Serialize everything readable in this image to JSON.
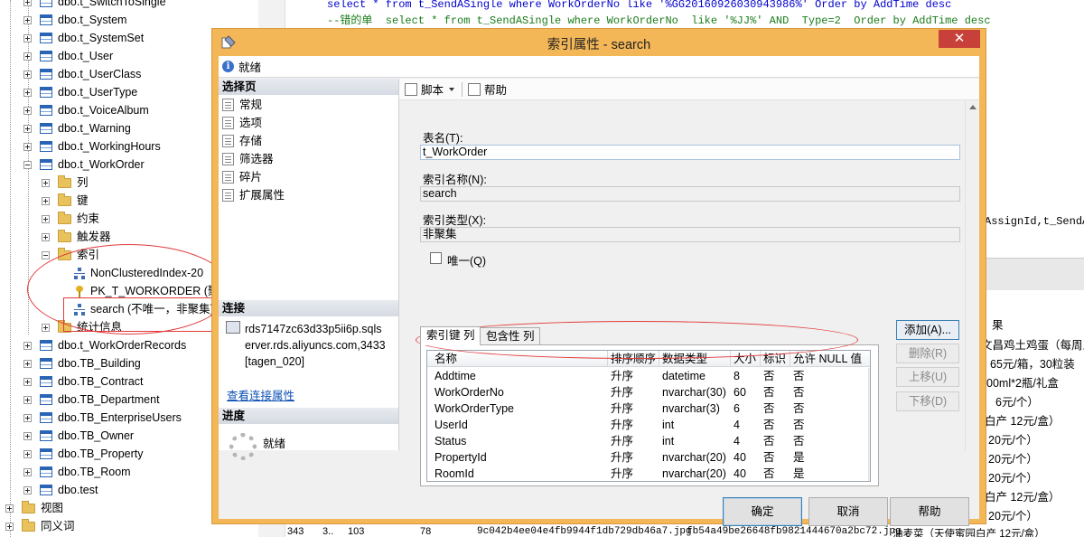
{
  "explorer": {
    "rows": [
      {
        "label": "dbo.t_SwitchToSingle"
      },
      {
        "label": "dbo.t_System"
      },
      {
        "label": "dbo.t_SystemSet"
      },
      {
        "label": "dbo.t_User"
      },
      {
        "label": "dbo.t_UserClass"
      },
      {
        "label": "dbo.t_UserType"
      },
      {
        "label": "dbo.t_VoiceAlbum"
      },
      {
        "label": "dbo.t_Warning"
      },
      {
        "label": "dbo.t_WorkingHours"
      },
      {
        "label": "dbo.t_WorkOrder"
      },
      {
        "label": "列"
      },
      {
        "label": "键"
      },
      {
        "label": "约束"
      },
      {
        "label": "触发器"
      },
      {
        "label": "索引"
      },
      {
        "label": "NonClusteredIndex-20"
      },
      {
        "label": "PK_T_WORKORDER (聚"
      },
      {
        "label": "search (不唯一，非聚集)"
      },
      {
        "label": "统计信息"
      },
      {
        "label": "dbo.t_WorkOrderRecords"
      },
      {
        "label": "dbo.TB_Building"
      },
      {
        "label": "dbo.TB_Contract"
      },
      {
        "label": "dbo.TB_Department"
      },
      {
        "label": "dbo.TB_EnterpriseUsers"
      },
      {
        "label": "dbo.TB_Owner"
      },
      {
        "label": "dbo.TB_Property"
      },
      {
        "label": "dbo.TB_Room"
      },
      {
        "label": "dbo.test"
      },
      {
        "label": "视图"
      },
      {
        "label": "同义词"
      }
    ]
  },
  "editor": {
    "line1": "select * from t_SendASingle where WorkOrderNo like '%GG20160926030943986%' Order by AddTime desc",
    "line2": "--错的单  select * from t_SendASingle where WorkOrderNo  like '%JJ%' AND  Type=2  Order by AddTime desc",
    "right_fragment": "AssignId,t_SendA",
    "results_header": "果",
    "result_lines": [
      "文昌鸡土鸡蛋（每周五",
      "65元/箱，30粒装",
      "00ml*2瓶/礼盒",
      "6元/个）",
      "白产 12元/盒）",
      "20元/个）",
      "20元/个）",
      "20元/个）",
      "白产 12元/盒）"
    ],
    "bottom_row": {
      "c1": "343",
      "c2": "3..",
      "c3": "103",
      "c4": "78",
      "c5": "9c042b4ee04e4fb9944f1db729db46a7.jpg",
      "c6": "fb54a49be26648fb9821444670a2bc72.jpg",
      "c7": "油麦菜（天使蜜园白产 12元/盒）"
    }
  },
  "dialog": {
    "title": "索引属性 - search",
    "close_glyph": "✕",
    "status": "就绪",
    "select_page_header": "选择页",
    "pages": [
      {
        "label": "常规"
      },
      {
        "label": "选项"
      },
      {
        "label": "存储"
      },
      {
        "label": "筛选器"
      },
      {
        "label": "碎片"
      },
      {
        "label": "扩展属性"
      }
    ],
    "connection_header": "连接",
    "connection_text_line1": "rds7147zc63d33p5ii6p.sqls",
    "connection_text_line2": "erver.rds.aliyuncs.com,3433",
    "connection_text_line3": "[tagen_020]",
    "view_connection_link": "查看连接属性",
    "progress_header": "进度",
    "progress_text": "就绪",
    "toolbar": {
      "script": "脚本",
      "help": "帮助"
    },
    "table_name_label": "表名(T):",
    "table_name_value": "t_WorkOrder",
    "index_name_label": "索引名称(N):",
    "index_name_value": "search",
    "index_type_label": "索引类型(X):",
    "index_type_value": "非聚集",
    "unique_label": "唯一(Q)",
    "tabs": [
      {
        "label": "索引键 列"
      },
      {
        "label": "包含性 列"
      }
    ],
    "grid": {
      "headers": [
        "名称",
        "排序顺序",
        "数据类型",
        "大小",
        "标识",
        "允许 NULL 值"
      ],
      "rows": [
        [
          "Addtime",
          "升序",
          "datetime",
          "8",
          "否",
          "否"
        ],
        [
          "WorkOrderNo",
          "升序",
          "nvarchar(30)",
          "60",
          "否",
          "否"
        ],
        [
          "WorkOrderType",
          "升序",
          "nvarchar(3)",
          "6",
          "否",
          "否"
        ],
        [
          "UserId",
          "升序",
          "int",
          "4",
          "否",
          "否"
        ],
        [
          "Status",
          "升序",
          "int",
          "4",
          "否",
          "否"
        ],
        [
          "PropertyId",
          "升序",
          "nvarchar(20)",
          "40",
          "否",
          "是"
        ],
        [
          "RoomId",
          "升序",
          "nvarchar(20)",
          "40",
          "否",
          "是"
        ]
      ]
    },
    "side_buttons": {
      "add": "添加(A)...",
      "delete": "删除(R)",
      "move_up": "上移(U)",
      "move_down": "下移(D)"
    },
    "footer": {
      "ok": "确定",
      "cancel": "取消",
      "help": "帮助"
    }
  },
  "colors": {
    "dialog_frame": "#f4b757",
    "close_button": "#c7413a",
    "annotation": "#e23b3b",
    "link": "#0b4fb3"
  }
}
